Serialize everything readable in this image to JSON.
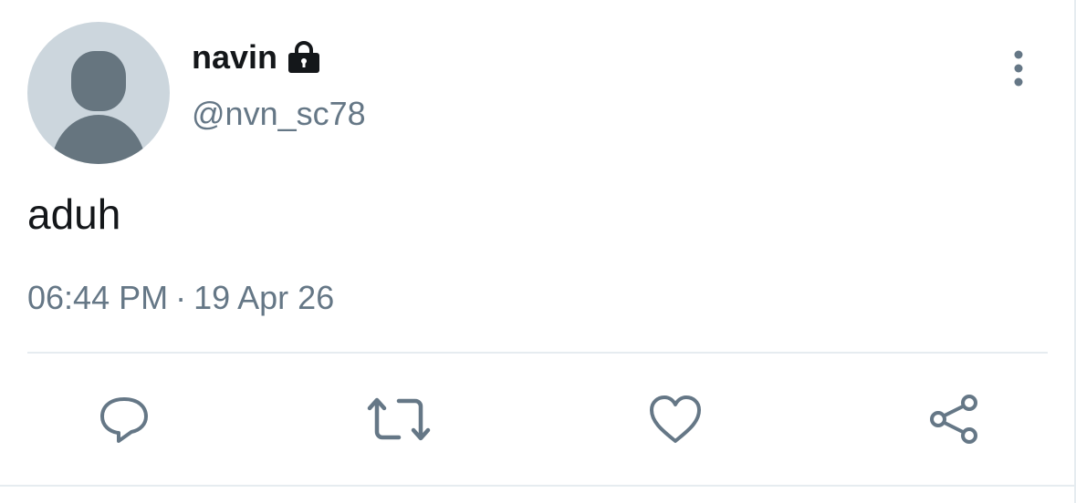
{
  "tweet": {
    "display_name": "navin",
    "handle": "@nvn_sc78",
    "protected": true,
    "text": "aduh",
    "time": "06:44 PM",
    "separator": "·",
    "date": "19 Apr 26"
  },
  "icons": {
    "avatar": "default-avatar-icon",
    "lock": "lock-icon",
    "more": "more-vertical-icon",
    "reply": "reply-icon",
    "retweet": "retweet-icon",
    "like": "heart-icon",
    "share": "share-icon"
  },
  "colors": {
    "text": "#14171a",
    "secondary": "#657786",
    "avatar_bg": "#ccd6dd",
    "avatar_fg": "#66757f",
    "divider": "#e6ecf0"
  }
}
